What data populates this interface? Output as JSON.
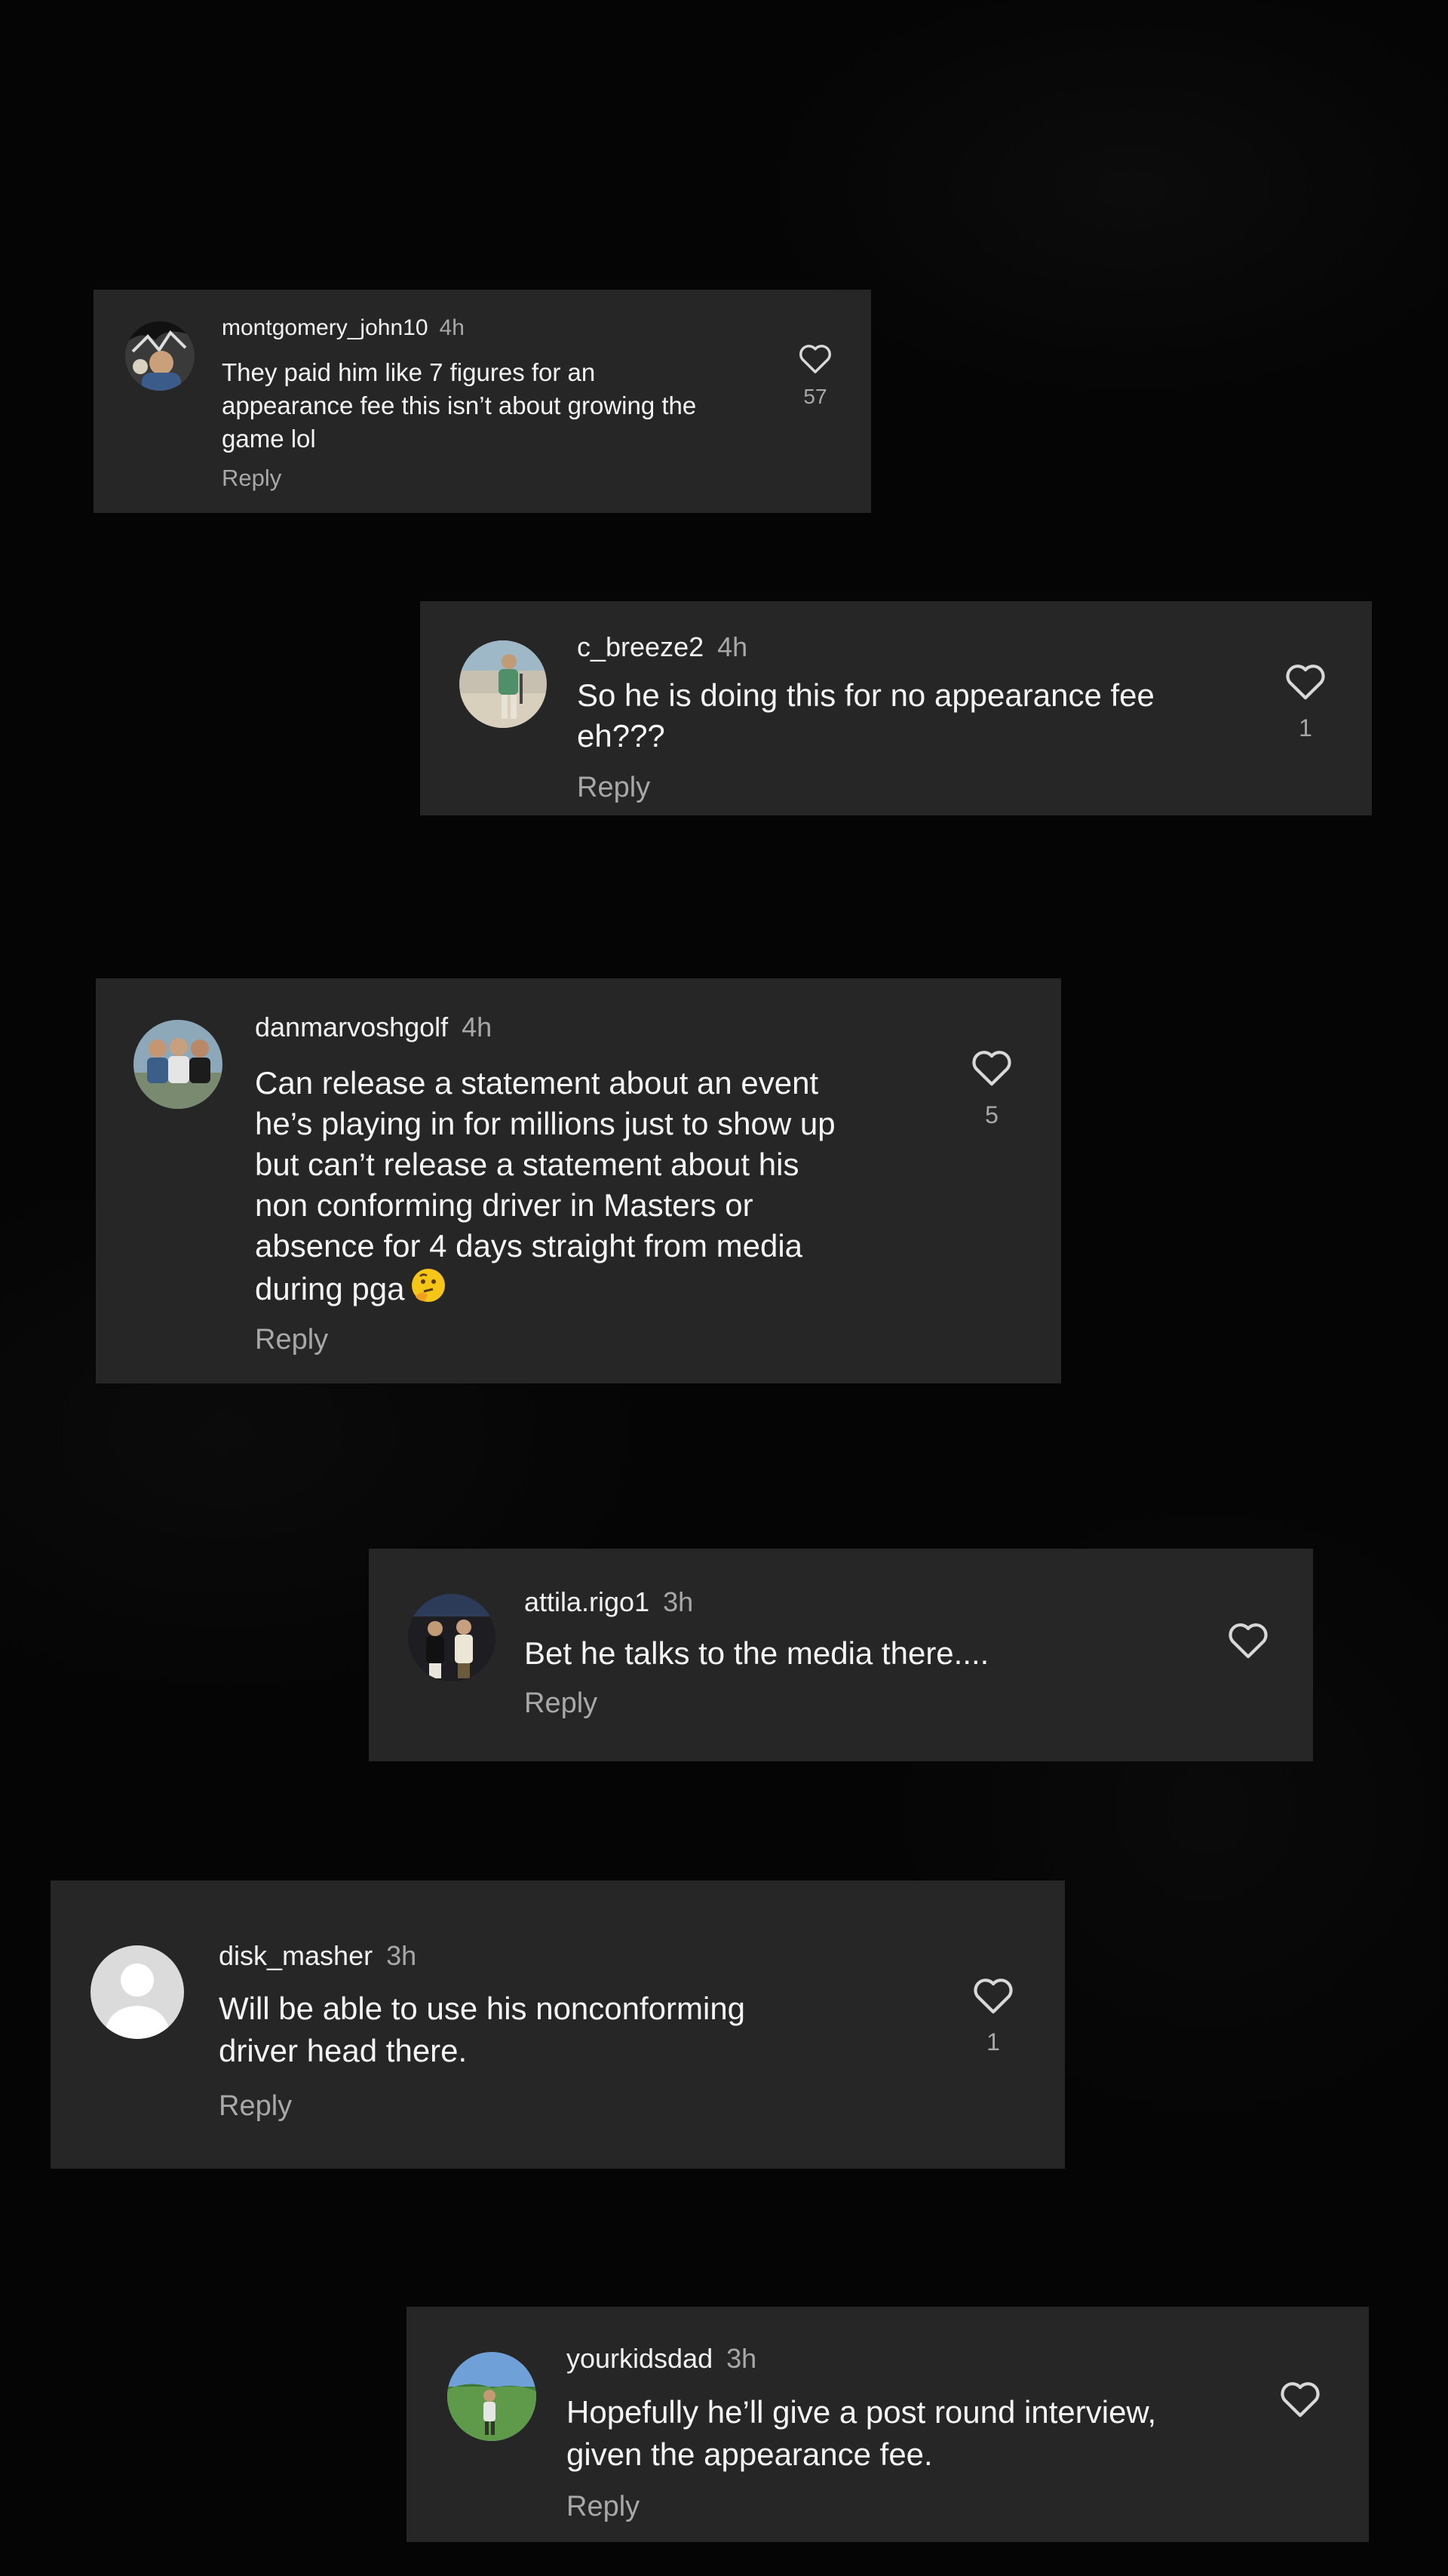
{
  "comments": [
    {
      "username": "montgomery_john10",
      "time": "4h",
      "text": "They paid him like 7 figures for an\nappearance fee this isn’t about growing the\ngame lol",
      "reply": "Reply",
      "likes": "57",
      "avatar_icon": "profile-photo"
    },
    {
      "username": "c_breeze2",
      "time": "4h",
      "text": "So he is doing this for no appearance fee\neh???",
      "reply": "Reply",
      "likes": "1",
      "avatar_icon": "profile-photo"
    },
    {
      "username": "danmarvoshgolf",
      "time": "4h",
      "text": "Can release a statement about an event\nhe’s playing in for millions just to show up\nbut can’t release a statement about his\nnon conforming driver in Masters or\nabsence for 4 days straight from media\nduring pga",
      "emoji": "thinking-face",
      "reply": "Reply",
      "likes": "5",
      "avatar_icon": "profile-photo"
    },
    {
      "username": "attila.rigo1",
      "time": "3h",
      "text": "Bet he talks to the media there....",
      "reply": "Reply",
      "likes": "",
      "avatar_icon": "profile-photo"
    },
    {
      "username": "disk_masher",
      "time": "3h",
      "text": "Will be able to use his nonconforming\ndriver head there.",
      "reply": "Reply",
      "likes": "1",
      "avatar_icon": "default-avatar"
    },
    {
      "username": "yourkidsdad",
      "time": "3h",
      "text": "Hopefully he’ll give a post round interview,\ngiven the appearance fee.",
      "reply": "Reply",
      "likes": "",
      "avatar_icon": "profile-photo"
    }
  ],
  "colors": {
    "background": "#050505",
    "card": "#262626",
    "text": "#f5f5f5",
    "muted": "#a8a8a8"
  }
}
